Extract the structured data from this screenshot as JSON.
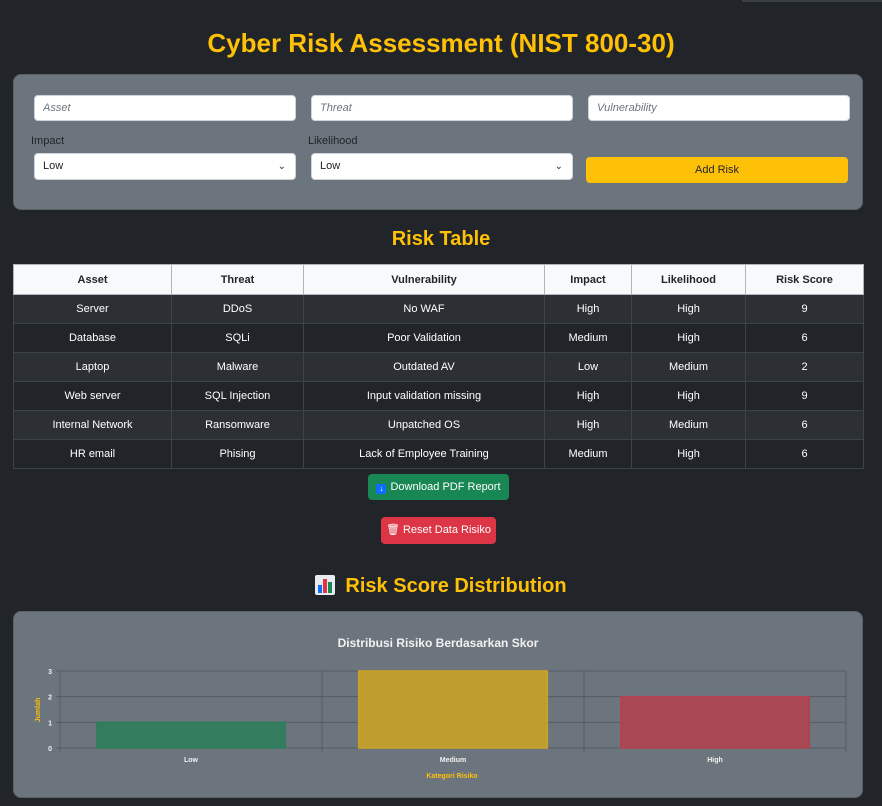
{
  "page_title": "Cyber Risk Assessment (NIST 800-30)",
  "form": {
    "asset_placeholder": "Asset",
    "threat_placeholder": "Threat",
    "vulnerability_placeholder": "Vulnerability",
    "impact_label": "Impact",
    "impact_value": "Low",
    "likelihood_label": "Likelihood",
    "likelihood_value": "Low",
    "add_button": "Add Risk"
  },
  "risk_table": {
    "title": "Risk Table",
    "headers": [
      "Asset",
      "Threat",
      "Vulnerability",
      "Impact",
      "Likelihood",
      "Risk Score"
    ],
    "rows": [
      [
        "Server",
        "DDoS",
        "No WAF",
        "High",
        "High",
        "9"
      ],
      [
        "Database",
        "SQLi",
        "Poor Validation",
        "Medium",
        "High",
        "6"
      ],
      [
        "Laptop",
        "Malware",
        "Outdated AV",
        "Low",
        "Medium",
        "2"
      ],
      [
        "Web server",
        "SQL Injection",
        "Input validation missing",
        "High",
        "High",
        "9"
      ],
      [
        "Internal Network",
        "Ransomware",
        "Unpatched OS",
        "High",
        "Medium",
        "6"
      ],
      [
        "HR email",
        "Phising",
        "Lack of Employee Training",
        "Medium",
        "High",
        "6"
      ]
    ]
  },
  "actions": {
    "download_pdf": "Download PDF Report",
    "download_icon": "download-icon",
    "reset": "Reset Data Risiko",
    "reset_icon": "trash-icon"
  },
  "chart_section": {
    "title": "Risk Score Distribution",
    "icon": "bar-chart-icon"
  },
  "colors": {
    "accent": "#ffc107",
    "success": "#198754",
    "danger": "#dc3545",
    "bar_low": "#2e7d5b",
    "bar_medium": "#c9a227",
    "bar_high": "#b0434f"
  },
  "chart_data": {
    "type": "bar",
    "title": "Distribusi Risiko Berdasarkan Skor",
    "categories": [
      "Low",
      "Medium",
      "High"
    ],
    "values": [
      1,
      3,
      2
    ],
    "xlabel": "Kategori Risiko",
    "ylabel": "Jumlah",
    "ylim": [
      0,
      3
    ],
    "yticks": [
      "0",
      "1",
      "2",
      "3"
    ],
    "grid": true,
    "legend": "none"
  }
}
